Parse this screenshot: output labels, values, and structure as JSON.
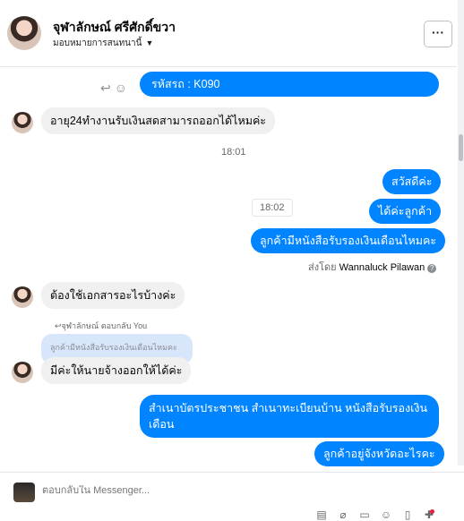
{
  "header": {
    "name": "จุฬาลักษณ์ ศรีศักดิ์ขวา",
    "subtitle": "มอบหมายการสนทนานี้",
    "more_label": "···"
  },
  "messages": {
    "code": "รหัสรถ : K090",
    "q1": "อายุ24ทำงานรับเงินสดสามารถออกได้ไหมค่ะ",
    "time1": "18:01",
    "hello": "สวัสดีค่ะ",
    "yes": "ได้ค่ะลูกค้า",
    "salary_q": "ลูกค้ามีหนังสือรับรองเงินเดือนไหมคะ",
    "time2": "18:02",
    "sent_by_prefix": "ส่งโดย",
    "sent_by_name": "Wannaluck Pilawan",
    "q2": "ต้องใช้เอกสารอะไรบ้างค่ะ",
    "reply_label": "↩จุฬาลักษณ์ ตอบกลับ You",
    "quoted": "ลูกค้ามีหนังสือรับรองเงินเดือนไหมคะ",
    "q3": "มีค่ะให้นายจ้างออกให้ได้ค่ะ",
    "docs_line1": "สำเนาบัตรประชาชน สำเนาทะเบียนบ้าน  หนังสือรับรองเงิน",
    "docs_line2": "เดือน",
    "province": "ลูกค้าอยู่จังหวัดอะไรคะ"
  },
  "composer": {
    "placeholder": "ตอบกลับใน Messenger..."
  },
  "icons": {
    "reply": "reply-icon",
    "emoji": "emoji-icon",
    "help": "help-icon",
    "tools": [
      "attachment-icon",
      "clip-icon",
      "gif-icon",
      "emoji-icon",
      "like-icon",
      "plus-icon"
    ]
  },
  "colors": {
    "outgoing": "#0084ff",
    "incoming": "#f0f0f0",
    "quote": "#d8e6fb"
  }
}
